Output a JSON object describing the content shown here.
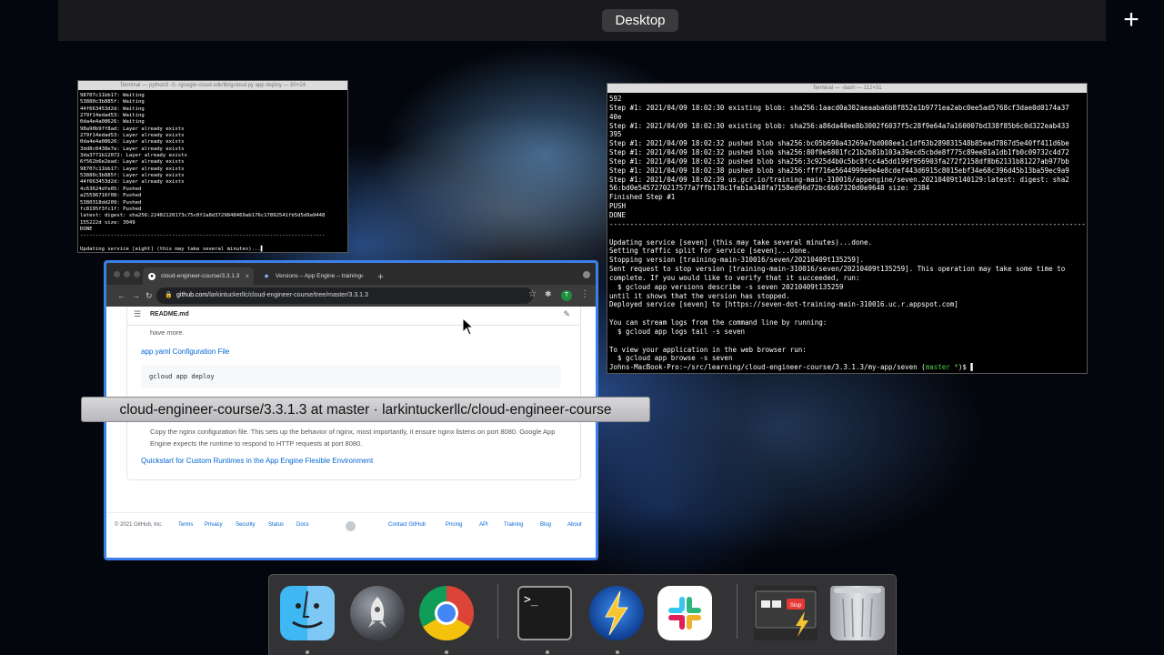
{
  "spaces": {
    "desktop_label": "Desktop",
    "add_label": "+"
  },
  "term_small": {
    "title": "Terminal — python3 -S -/google-cloud-sdk/lib/gcloud.py app deploy — 80×24",
    "lines": [
      "98707c11bb17: Waiting",
      "53880c3b885f: Waiting",
      "44f663453d2d: Waiting",
      "279f14edad53: Waiting",
      "0da4e4a08626: Waiting",
      "98a90b9ff8ad: Layer already exists",
      "279f14edad53: Layer already exists",
      "0da4e4a08626: Layer already exists",
      "3dd8c0438e7e: Layer already exists",
      "3da3771b12072: Layer already exists",
      "6f562b6e2ead: Layer already exists",
      "98707c11bb17: Layer already exists",
      "53880c3b885f: Layer already exists",
      "44f663453d2d: Layer already exists",
      "4c63624dfe05: Pushed",
      "a25596716f08: Pushed",
      "5380318dd209: Pushed",
      "fc8195f3fc1f: Pushed",
      "latest: digest: sha256:22402120173c75c0f2a8d3729848469ab176c17892541fb5d5d9a9448",
      "155222d size: 3049",
      "DONE",
      "--------------------------------------------------------------------------------",
      "",
      "Updating service [eight] (this may take several minutes)...▌"
    ]
  },
  "term_big": {
    "title": "Terminal — -bash — 112×31",
    "lines": [
      "592",
      "Step #1: 2021/04/09 18:02:30 existing blob: sha256:1aacd0a302aeaaba6b8f852e1b9771ea2abc0ee5ad5768cf3dae0d0174a37",
      "40e",
      "Step #1: 2021/04/09 18:02:30 existing blob: sha256:a86da40ee8b3002f6037f5c28f9e64a7a160007bd338f85b6c0d322eab433",
      "395",
      "Step #1: 2021/04/09 18:02:32 pushed blob sha256:bc05b690a43269a7bd008ee1c1df63b289831548b85ead7867d5e40ff411d6be",
      "Step #1: 2021/04/09 18:02:32 pushed blob sha256:80f0e6801fc21b2b81b103a39ecd5cbde8f775c89ee81a1db1fb0c09732c4d72",
      "Step #1: 2021/04/09 18:02:32 pushed blob sha256:3c925d4b0c5bc8fcc4a5dd199f956903fa272f2158df8b62131b81227ab977bb",
      "Step #1: 2021/04/09 18:02:38 pushed blob sha256:fff716e5644999e9e4e8cdef443d6915c8015ebf34e68c396d45b13ba59ec9a9",
      "Step #1: 2021/04/09 18:02:39 us.gcr.io/training-main-310016/appengine/seven.20210409t140129:latest: digest: sha2",
      "56:bd0e5457270217577a7ffb178c1feb1a348fa7158ed96d72bc6b67320d0e9648 size: 2384",
      "Finished Step #1",
      "PUSH",
      "DONE",
      "--------------------------------------------------------------------------------------------------------------------",
      "",
      "Updating service [seven] (this may take several minutes)...done.",
      "Setting traffic split for service [seven]...done.",
      "Stopping version [training-main-310016/seven/20210409t135259].",
      "Sent request to stop version [training-main-310016/seven/20210409t135259]. This operation may take some time to",
      "complete. If you would like to verify that it succeeded, run:",
      "  $ gcloud app versions describe -s seven 20210409t135259",
      "until it shows that the version has stopped.",
      "Deployed service [seven] to [https://seven-dot-training-main-310016.uc.r.appspot.com]",
      "",
      "You can stream logs from the command line by running:",
      "  $ gcloud app logs tail -s seven",
      "",
      "To view your application in the web browser run:",
      "  $ gcloud app browse -s seven"
    ],
    "prompt_prefix": "Johns-MacBook-Pro:~/src/learning/cloud-engineer-course/3.3.1.3/my-app/seven (",
    "prompt_branch": "master *",
    "prompt_suffix": ")$ ▌"
  },
  "browser": {
    "tab1_title": "cloud-engineer-course/3.3.1.3",
    "tab2_title": "Versions – App Engine – training",
    "url_host": "github.com",
    "url_path": "/larkintuckerllc/cloud-engineer-course/tree/master/3.3.1.3",
    "avatar_letter": "T",
    "readme_title": "README.md",
    "have_more": "have more.",
    "link_app_yaml": "app.yaml Configuration File",
    "code_deploy": "gcloud app deploy",
    "nginx_text": "Copy the nginx configuration file. This sets up the behavior of nginx, most importantly, it ensure nginx listens on port 8080. Google App Engine expects the runtime to respond to HTTP requests at port 8080.",
    "link_quickstart": "Quickstart for Custom Runtimes in the App Engine Flexible Environment",
    "footer": {
      "copyright": "© 2021 GitHub, Inc.",
      "terms": "Terms",
      "privacy": "Privacy",
      "security": "Security",
      "status": "Status",
      "docs": "Docs",
      "contact": "Contact GitHub",
      "pricing": "Pricing",
      "api": "API",
      "training": "Training",
      "blog": "Blog",
      "about": "About"
    }
  },
  "tooltip": "cloud-engineer-course/3.3.1.3 at master · larkintuckerllc/cloud-engineer-course",
  "dock": {
    "items": [
      "finder-icon",
      "launchpad-icon",
      "chrome-icon",
      "terminal-icon",
      "reeder-icon",
      "slack-icon",
      "screen-recorder-icon",
      "trash-icon"
    ],
    "terminal_glyph": ">_",
    "recorder_stop": "Stop"
  }
}
